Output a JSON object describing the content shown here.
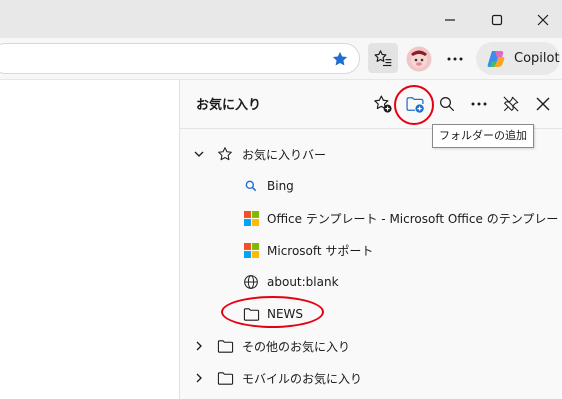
{
  "favorites_panel": {
    "title": "お気に入り",
    "tooltip": "フォルダーの追加",
    "tree": {
      "bar_folder": "お気に入りバー",
      "items": [
        {
          "label": "Bing"
        },
        {
          "label": "Office テンプレート - Microsoft Office のテンプレー"
        },
        {
          "label": "Microsoft サポート"
        },
        {
          "label": "about:blank"
        },
        {
          "label": "NEWS"
        }
      ],
      "other_favorites": "その他のお気に入り",
      "mobile_favorites": "モバイルのお気に入り"
    }
  },
  "toolbar": {
    "copilot_label": "Copilot"
  },
  "colors": {
    "accent": "#1f6fd1",
    "highlight_circle": "#e60012",
    "panel_bg": "#f9f9f9"
  }
}
